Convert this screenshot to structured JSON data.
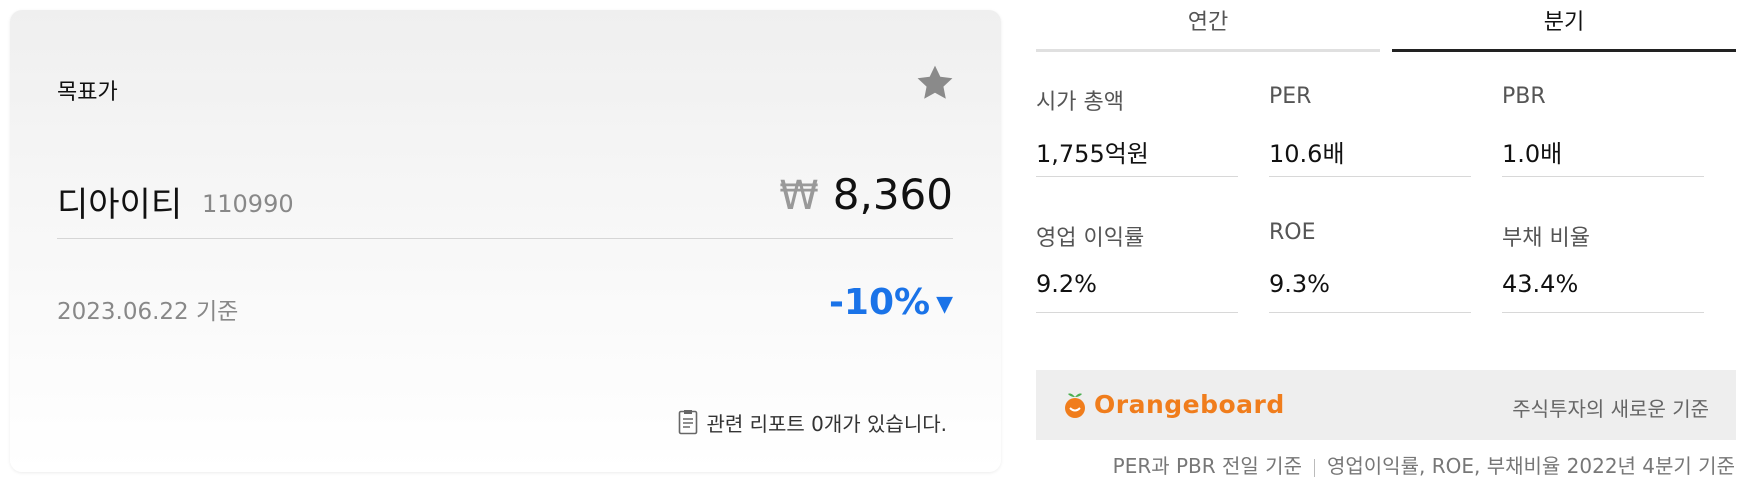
{
  "target_card": {
    "title": "목표가",
    "company_name": "디아이티",
    "stock_code": "110990",
    "currency_symbol": "₩",
    "target_price": "8,360",
    "basis_date": "2023.06.22 기준",
    "change": "-10%",
    "change_color": "#1a73e8",
    "reports_text": "관련 리포트 0개가 있습니다."
  },
  "tabs": [
    {
      "label": "연간",
      "active": false
    },
    {
      "label": "분기",
      "active": true
    }
  ],
  "metrics": [
    {
      "label": "시가 총액",
      "value": "1,755억원"
    },
    {
      "label": "PER",
      "value": "10.6배"
    },
    {
      "label": "PBR",
      "value": "1.0배"
    },
    {
      "label": "영업 이익률",
      "value": "9.2%"
    },
    {
      "label": "ROE",
      "value": "9.3%"
    },
    {
      "label": "부채 비율",
      "value": "43.4%"
    }
  ],
  "banner": {
    "brand": "Orangeboard",
    "brand_color": "#f07d1c",
    "tagline": "주식투자의 새로운 기준"
  },
  "footnote": {
    "left": "PER과 PBR 전일 기준",
    "right": "영업이익률, ROE, 부채비율 2022년 4분기 기준"
  },
  "icons": [
    "star-icon",
    "won-icon",
    "down-triangle-icon",
    "document-icon",
    "orange-icon"
  ]
}
